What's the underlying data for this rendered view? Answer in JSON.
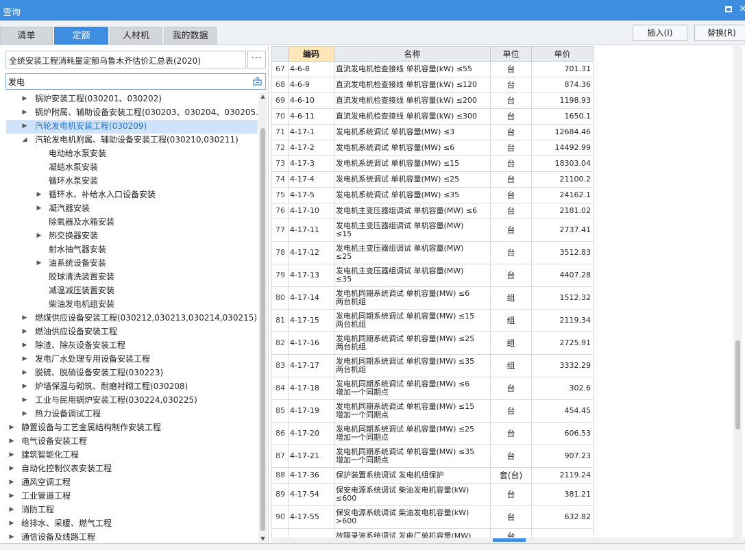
{
  "window": {
    "title": "查询"
  },
  "tabs": [
    {
      "label": "清单",
      "active": false
    },
    {
      "label": "定额",
      "active": true
    },
    {
      "label": "人材机",
      "active": false
    },
    {
      "label": "我的数据",
      "active": false
    }
  ],
  "toolbar": {
    "insert_label": "插入(I)",
    "replace_label": "替换(R)"
  },
  "library": {
    "name": "全统安装工程消耗量定额乌鲁木齐估价汇总表(2020)",
    "more_label": "···"
  },
  "search": {
    "value": "发电"
  },
  "tree": [
    {
      "label": "锅炉安装工程(030201、030202)",
      "level": 2,
      "expand": "collapsed",
      "selected": false
    },
    {
      "label": "锅炉附属、辅助设备安装工程(030203、030204、030205...",
      "level": 2,
      "expand": "collapsed",
      "selected": false
    },
    {
      "label": "汽轮发电机安装工程(030209)",
      "level": 2,
      "expand": "collapsed",
      "selected": true
    },
    {
      "label": "汽轮发电机附属、辅助设备安装工程(030210,030211)",
      "level": 2,
      "expand": "expanded",
      "selected": false
    },
    {
      "label": "电动给水泵安装",
      "level": 3,
      "expand": "none",
      "selected": false
    },
    {
      "label": "凝结水泵安装",
      "level": 3,
      "expand": "none",
      "selected": false
    },
    {
      "label": "循环水泵安装",
      "level": 3,
      "expand": "none",
      "selected": false
    },
    {
      "label": "循环水、补给水入口设备安装",
      "level": 3,
      "expand": "collapsed",
      "selected": false
    },
    {
      "label": "凝汽器安装",
      "level": 3,
      "expand": "collapsed",
      "selected": false
    },
    {
      "label": "除氧器及水箱安装",
      "level": 3,
      "expand": "none",
      "selected": false
    },
    {
      "label": "热交换器安装",
      "level": 3,
      "expand": "collapsed",
      "selected": false
    },
    {
      "label": "射水抽气器安装",
      "level": 3,
      "expand": "none",
      "selected": false
    },
    {
      "label": "油系统设备安装",
      "level": 3,
      "expand": "collapsed",
      "selected": false
    },
    {
      "label": "胶球清洗装置安装",
      "level": 3,
      "expand": "none",
      "selected": false
    },
    {
      "label": "减温减压装置安装",
      "level": 3,
      "expand": "none",
      "selected": false
    },
    {
      "label": "柴油发电机组安装",
      "level": 3,
      "expand": "none",
      "selected": false
    },
    {
      "label": "燃煤供应设备安装工程(030212,030213,030214,030215)",
      "level": 2,
      "expand": "collapsed",
      "selected": false
    },
    {
      "label": "燃油供应设备安装工程",
      "level": 2,
      "expand": "collapsed",
      "selected": false
    },
    {
      "label": "除渣、除灰设备安装工程",
      "level": 2,
      "expand": "collapsed",
      "selected": false
    },
    {
      "label": "发电厂水处理专用设备安装工程",
      "level": 2,
      "expand": "collapsed",
      "selected": false
    },
    {
      "label": "脱硫、脱硝设备安装工程(030223)",
      "level": 2,
      "expand": "collapsed",
      "selected": false
    },
    {
      "label": "炉墙保温与砌筑、耐磨衬砌工程(030208)",
      "level": 2,
      "expand": "collapsed",
      "selected": false
    },
    {
      "label": "工业与民用锅炉安装工程(030224,030225)",
      "level": 2,
      "expand": "collapsed",
      "selected": false
    },
    {
      "label": "热力设备调试工程",
      "level": 2,
      "expand": "collapsed",
      "selected": false
    },
    {
      "label": "静置设备与工艺金属结构制作安装工程",
      "level": 1,
      "expand": "collapsed",
      "selected": false
    },
    {
      "label": "电气设备安装工程",
      "level": 1,
      "expand": "collapsed",
      "selected": false
    },
    {
      "label": "建筑智能化工程",
      "level": 1,
      "expand": "collapsed",
      "selected": false
    },
    {
      "label": "自动化控制仪表安装工程",
      "level": 1,
      "expand": "collapsed",
      "selected": false
    },
    {
      "label": "通风空调工程",
      "level": 1,
      "expand": "collapsed",
      "selected": false
    },
    {
      "label": "工业管道工程",
      "level": 1,
      "expand": "collapsed",
      "selected": false
    },
    {
      "label": "消防工程",
      "level": 1,
      "expand": "collapsed",
      "selected": false
    },
    {
      "label": "给排水、采暖、燃气工程",
      "level": 1,
      "expand": "collapsed",
      "selected": false
    },
    {
      "label": "通信设备及线路工程",
      "level": 1,
      "expand": "collapsed",
      "selected": false
    }
  ],
  "grid": {
    "headers": {
      "code": "编码",
      "name": "名称",
      "unit": "单位",
      "price": "单价"
    },
    "rows": [
      {
        "idx": "67",
        "code": "4-6-8",
        "name": [
          "直流发电机检查接线 单机容量(kW) ≤55"
        ],
        "unit": "台",
        "price": "701.31"
      },
      {
        "idx": "68",
        "code": "4-6-9",
        "name": [
          "直流发电机检查接线 单机容量(kW) ≤120"
        ],
        "unit": "台",
        "price": "874.36"
      },
      {
        "idx": "69",
        "code": "4-6-10",
        "name": [
          "直流发电机检查接线 单机容量(kW) ≤200"
        ],
        "unit": "台",
        "price": "1198.93"
      },
      {
        "idx": "70",
        "code": "4-6-11",
        "name": [
          "直流发电机检查接线 单机容量(kW) ≤300"
        ],
        "unit": "台",
        "price": "1650.1"
      },
      {
        "idx": "71",
        "code": "4-17-1",
        "name": [
          "发电机系统调试 单机容量(MW) ≤3"
        ],
        "unit": "台",
        "price": "12684.46"
      },
      {
        "idx": "72",
        "code": "4-17-2",
        "name": [
          "发电机系统调试 单机容量(MW) ≤6"
        ],
        "unit": "台",
        "price": "14492.99"
      },
      {
        "idx": "73",
        "code": "4-17-3",
        "name": [
          "发电机系统调试 单机容量(MW) ≤15"
        ],
        "unit": "台",
        "price": "18303.04"
      },
      {
        "idx": "74",
        "code": "4-17-4",
        "name": [
          "发电机系统调试 单机容量(MW) ≤25"
        ],
        "unit": "台",
        "price": "21100.2"
      },
      {
        "idx": "75",
        "code": "4-17-5",
        "name": [
          "发电机系统调试 单机容量(MW) ≤35"
        ],
        "unit": "台",
        "price": "24162.1"
      },
      {
        "idx": "76",
        "code": "4-17-10",
        "name": [
          "发电机主变压器组调试 单机容量(MW) ≤6"
        ],
        "unit": "台",
        "price": "2181.02"
      },
      {
        "idx": "77",
        "code": "4-17-11",
        "name": [
          "发电机主变压器组调试 单机容量(MW)",
          "≤15"
        ],
        "unit": "台",
        "price": "2737.41"
      },
      {
        "idx": "78",
        "code": "4-17-12",
        "name": [
          "发电机主变压器组调试 单机容量(MW)",
          "≤25"
        ],
        "unit": "台",
        "price": "3512.83"
      },
      {
        "idx": "79",
        "code": "4-17-13",
        "name": [
          "发电机主变压器组调试 单机容量(MW)",
          "≤35"
        ],
        "unit": "台",
        "price": "4407.28"
      },
      {
        "idx": "80",
        "code": "4-17-14",
        "name": [
          "发电机同期系统调试 单机容量(MW) ≤6",
          "两台机组"
        ],
        "unit": "组",
        "price": "1512.32"
      },
      {
        "idx": "81",
        "code": "4-17-15",
        "name": [
          "发电机同期系统调试 单机容量(MW) ≤15",
          "两台机组"
        ],
        "unit": "组",
        "price": "2119.34"
      },
      {
        "idx": "82",
        "code": "4-17-16",
        "name": [
          "发电机同期系统调试 单机容量(MW) ≤25",
          "两台机组"
        ],
        "unit": "组",
        "price": "2725.91"
      },
      {
        "idx": "83",
        "code": "4-17-17",
        "name": [
          "发电机同期系统调试 单机容量(MW) ≤35",
          "两台机组"
        ],
        "unit": "组",
        "price": "3332.29"
      },
      {
        "idx": "84",
        "code": "4-17-18",
        "name": [
          "发电机同期系统调试 单机容量(MW) ≤6",
          "增加一个同期点"
        ],
        "unit": "台",
        "price": "302.6"
      },
      {
        "idx": "85",
        "code": "4-17-19",
        "name": [
          "发电机同期系统调试 单机容量(MW) ≤15",
          "增加一个同期点"
        ],
        "unit": "台",
        "price": "454.45"
      },
      {
        "idx": "86",
        "code": "4-17-20",
        "name": [
          "发电机同期系统调试 单机容量(MW) ≤25",
          "增加一个同期点"
        ],
        "unit": "台",
        "price": "606.53"
      },
      {
        "idx": "87",
        "code": "4-17-21",
        "name": [
          "发电机同期系统调试 单机容量(MW) ≤35",
          "增加一个同期点"
        ],
        "unit": "台",
        "price": "907.23"
      },
      {
        "idx": "88",
        "code": "4-17-36",
        "name": [
          "保护装置系统调试 发电机组保护"
        ],
        "unit": "套(台)",
        "price": "2119.24"
      },
      {
        "idx": "89",
        "code": "4-17-54",
        "name": [
          "保安电源系统调试 柴油发电机容量(kW)",
          "≤600"
        ],
        "unit": "台",
        "price": "381.21"
      },
      {
        "idx": "90",
        "code": "4-17-55",
        "name": [
          "保安电源系统调试 柴油发电机容量(kW)",
          ">600"
        ],
        "unit": "台",
        "price": "632.82"
      },
      {
        "idx": "",
        "code": "",
        "name": [
          "故障录波系统调试 发电厂单机容量(MW)"
        ],
        "unit": "台",
        "price": ""
      }
    ]
  },
  "icons": {
    "search_action": "user-search-icon",
    "maximize": "maximize-icon",
    "close": "close-icon"
  },
  "colors": {
    "accent": "#3d8ee0",
    "selected_bg": "#cfe3fb",
    "code_header_bg": "#fde6b7"
  }
}
